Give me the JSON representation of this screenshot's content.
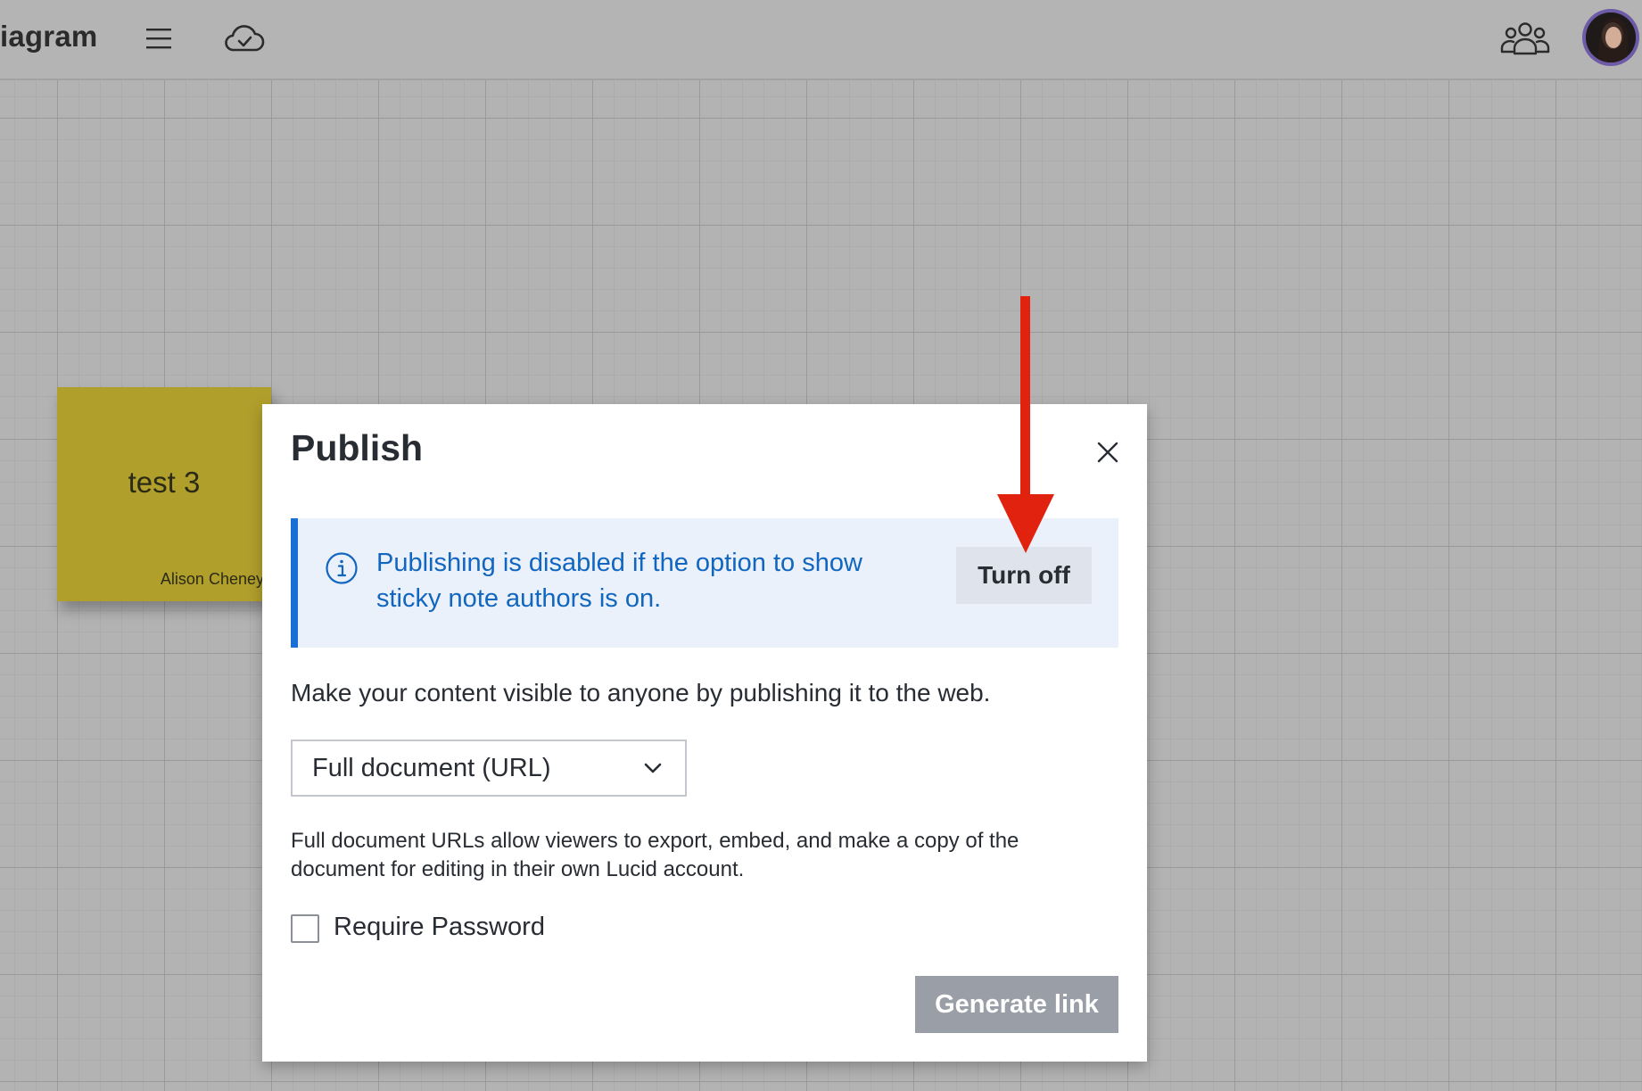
{
  "header": {
    "app_title": "iagram",
    "menu_icon": "hamburger-menu-icon",
    "cloud_icon": "cloud-saved-icon",
    "collaborators_icon": "people-group-icon"
  },
  "canvas": {
    "sticky_note": {
      "text": "test 3",
      "author": "Alison Cheney",
      "color": "#b19f2c"
    }
  },
  "modal": {
    "title": "Publish",
    "close_icon": "close-icon",
    "banner": {
      "icon": "info-icon",
      "message": "Publishing is disabled if the option to show sticky note authors is on.",
      "action_label": "Turn off",
      "accent_color": "#1a6fd4"
    },
    "description": "Make your content visible to anyone by publishing it to the web.",
    "publish_type": {
      "selected": "Full document (URL)"
    },
    "helper_text": "Full document URLs allow viewers to export, embed, and make a copy of the document for editing in their own Lucid account.",
    "require_password": {
      "label": "Require Password",
      "checked": false
    },
    "generate_label": "Generate link"
  },
  "annotation": {
    "arrow_color": "#e0220f"
  }
}
